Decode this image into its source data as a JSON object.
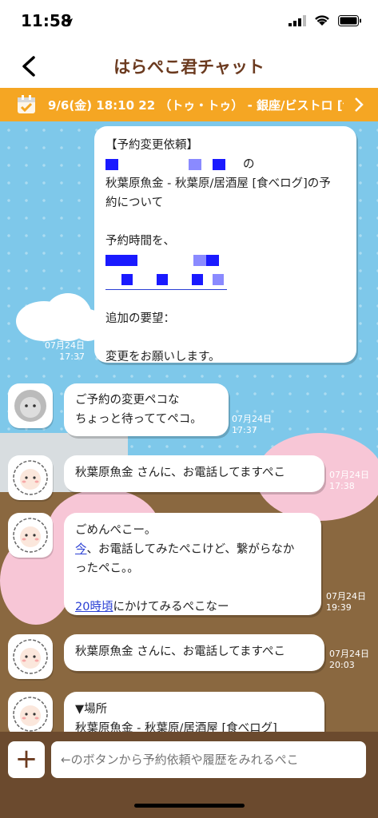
{
  "status": {
    "time": "11:58"
  },
  "nav": {
    "title": "はらぺこ君チャット"
  },
  "banner": {
    "text": "9/6(金) 18:10 22 （トゥ・トゥ） - 銀座/ビストロ [食…"
  },
  "messages": {
    "m1": {
      "header": "【予約変更依頼】",
      "line1_suffix": "の",
      "line2": "秋葉原魚金 - 秋葉原/居酒屋 [食べログ]の予",
      "line3": "約について",
      "line4": "予約時間を、",
      "line5": "追加の要望：",
      "line6": "変更をお願いします。",
      "date": "07月24日",
      "time": "17:37"
    },
    "m2": {
      "line1": "ご予約の変更ペコな",
      "line2": "ちょっと待っててペコ。",
      "date": "07月24日",
      "time": "17:37"
    },
    "m3": {
      "text": "秋葉原魚金 さんに、お電話してますぺこ",
      "date": "07月24日",
      "time": "17:38"
    },
    "m4": {
      "line1": "ごめんぺこー。",
      "link1": "今",
      "line2_rest": "、お電話してみたぺこけど、繋がらなか",
      "line3": "ったペこ。。",
      "link2": "20時頃",
      "line4_rest": "にかけてみるぺこなー",
      "date": "07月24日",
      "time": "19:39"
    },
    "m5": {
      "text": "秋葉原魚金 さんに、お電話してますぺこ",
      "date": "07月24日",
      "time": "20:03"
    },
    "m6": {
      "line1": "▼場所",
      "line2": "秋葉原魚金 - 秋葉原/居酒屋 [食べログ]"
    }
  },
  "input": {
    "plus": "+",
    "placeholder": "←のボタンから予約依頼や履歴をみれるぺこ"
  }
}
